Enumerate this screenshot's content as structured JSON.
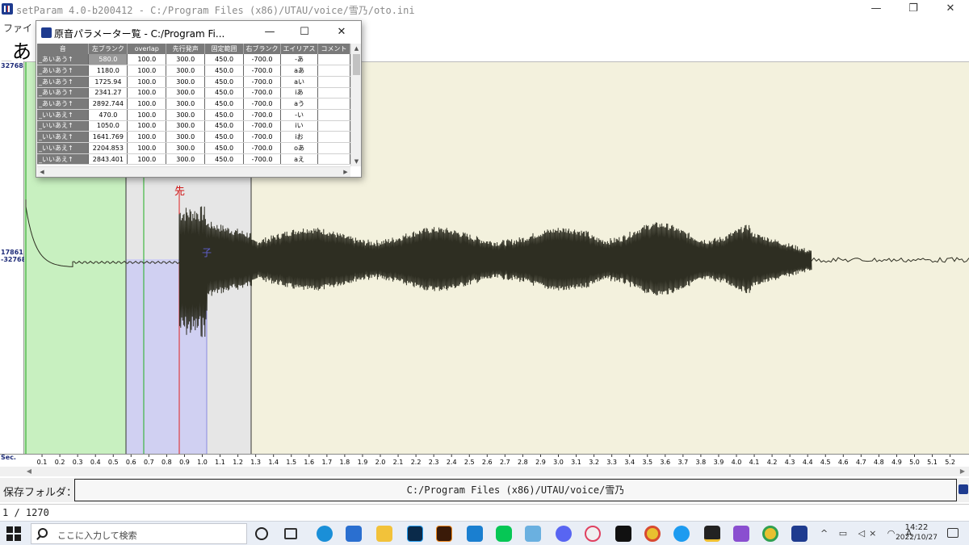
{
  "window": {
    "title": "setParam 4.0-b200412 -  C:/Program Files (x86)/UTAU/voice/雪乃/oto.ini",
    "min_glyph": "—",
    "max_glyph": "❐",
    "close_glyph": "✕"
  },
  "menu": {
    "file_label": "ファイ"
  },
  "current_entry_label": "_あ",
  "gutter": {
    "top_value": "32768",
    "mid_value": "17861",
    "mid_value2": "-32768",
    "sec_label": "Sec."
  },
  "markers": {
    "preutterance_label": "先",
    "consonant_label": "子"
  },
  "ruler": {
    "ticks": [
      "0.1",
      "0.2",
      "0.3",
      "0.4",
      "0.5",
      "0.6",
      "0.7",
      "0.8",
      "0.9",
      "1.0",
      "1.1",
      "1.2",
      "1.3",
      "1.4",
      "1.5",
      "1.6",
      "1.7",
      "1.8",
      "1.9",
      "2.0",
      "2.1",
      "2.2",
      "2.3",
      "2.4",
      "2.5",
      "2.6",
      "2.7",
      "2.8",
      "2.9",
      "3.0",
      "3.1",
      "3.2",
      "3.3",
      "3.4",
      "3.5",
      "3.6",
      "3.7",
      "3.8",
      "3.9",
      "4.0",
      "4.1",
      "4.2",
      "4.3",
      "4.4",
      "4.5",
      "4.6",
      "4.7",
      "4.8",
      "4.9",
      "5.0",
      "5.1",
      "5.2"
    ]
  },
  "save_folder": {
    "label": "保存フォルダ：",
    "path": "C:/Program Files (x86)/UTAU/voice/雪乃"
  },
  "status": {
    "text": "1 / 1270"
  },
  "dialog": {
    "title": "原音パラメーター覧 -  C:/Program Fi...",
    "min_glyph": "—",
    "max_glyph": "☐",
    "close_glyph": "✕",
    "columns": [
      "音",
      "左ブランク",
      "overlap",
      "先行発声",
      "固定範囲",
      "右ブランク",
      "エイリアス",
      "コメント"
    ],
    "rows": [
      [
        "_あいあう↑",
        "580.0",
        "100.0",
        "300.0",
        "450.0",
        "-700.0",
        "-あ",
        ""
      ],
      [
        "_あいあう↑",
        "1180.0",
        "100.0",
        "300.0",
        "450.0",
        "-700.0",
        "aあ",
        ""
      ],
      [
        "_あいあう↑",
        "1725.94",
        "100.0",
        "300.0",
        "450.0",
        "-700.0",
        "aい",
        ""
      ],
      [
        "_あいあう↑",
        "2341.27",
        "100.0",
        "300.0",
        "450.0",
        "-700.0",
        "iあ",
        ""
      ],
      [
        "_あいあう↑",
        "2892.744",
        "100.0",
        "300.0",
        "450.0",
        "-700.0",
        "aう",
        ""
      ],
      [
        "_いいあえ↑",
        "470.0",
        "100.0",
        "300.0",
        "450.0",
        "-700.0",
        "-い",
        ""
      ],
      [
        "_いいあえ↑",
        "1050.0",
        "100.0",
        "300.0",
        "450.0",
        "-700.0",
        "iい",
        ""
      ],
      [
        "_いいあえ↑",
        "1641.769",
        "100.0",
        "300.0",
        "450.0",
        "-700.0",
        "iお",
        ""
      ],
      [
        "_いいあえ↑",
        "2204.853",
        "100.0",
        "300.0",
        "450.0",
        "-700.0",
        "oあ",
        ""
      ],
      [
        "_いいあえ↑",
        "2843.401",
        "100.0",
        "300.0",
        "450.0",
        "-700.0",
        "aえ",
        ""
      ]
    ]
  },
  "taskbar": {
    "search_placeholder": "ここに入力して検索",
    "time": "14:22",
    "date": "2022/10/27",
    "tray_glyphs": "^ ▭ ◁× ◠ A"
  },
  "colors": {
    "waveform_bg": "#f3f1dd",
    "left_blank_region": "#c8f0c0",
    "fixed_region": "#d0d0f2",
    "preutterance_line": "#e02020",
    "overlap_line": "#20b020",
    "waveform": "#3a3a2a"
  }
}
